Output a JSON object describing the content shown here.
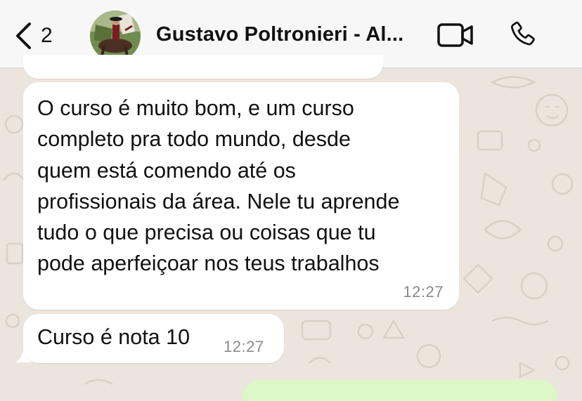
{
  "header": {
    "back_count": "2",
    "contact_name": "Gustavo Poltronieri - Al..."
  },
  "icons": {
    "back": "chevron-left-icon",
    "video": "video-camera-icon",
    "call": "phone-icon"
  },
  "messages": [
    {
      "lines": [
        "O curso é muito bom, e um curso",
        "completo pra todo mundo, desde",
        "quem está comendo até os",
        "profissionais da área. Nele tu aprende",
        "tudo o que precisa ou coisas que tu",
        "pode aperfeiçoar nos teus trabalhos"
      ],
      "time": "12:27"
    },
    {
      "text": "Curso é nota 10",
      "time": "12:27"
    }
  ],
  "colors": {
    "wallpaper": "#ece5dd",
    "incoming_bubble": "#ffffff",
    "outgoing_bubble": "#dcf8c6",
    "header_bg": "#f7f7f7"
  }
}
